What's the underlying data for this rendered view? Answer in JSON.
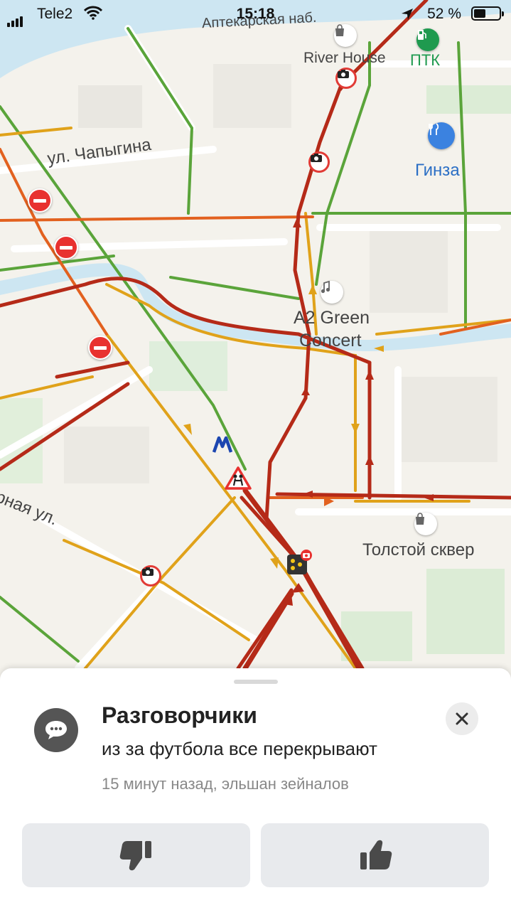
{
  "status_bar": {
    "carrier": "Tele2",
    "time": "15:18",
    "battery_percent": "52 %",
    "battery_level": 0.52
  },
  "map": {
    "labels": {
      "embankment": "Аптекарская наб.",
      "street_chapygina": "ул. Чапыгина",
      "street_partial": "рная ул.",
      "river_house": "River House",
      "ptk": "ПТК",
      "ginza": "Гинза",
      "a2_line1": "A2 Green",
      "a2_line2": "Concert",
      "tolstoy": "Толстой сквер"
    },
    "colors": {
      "jam": "#b52a18",
      "heavy": "#e2611f",
      "medium": "#e0a21a",
      "free": "#5aa43a",
      "water": "#cde6f2",
      "metro": "#1c46b0"
    },
    "icons": [
      "camera-icon",
      "no-entry-icon",
      "shopping-bag-icon",
      "fuel-icon",
      "restaurant-icon",
      "music-icon",
      "metro-icon",
      "children-warning-icon",
      "traffic-light-icon"
    ]
  },
  "sheet": {
    "title": "Разговорчики",
    "message": "из за  футбола все перекрывают",
    "meta": "15 минут назад, эльшан зейналов",
    "dislike_icon": "thumbs-down-icon",
    "like_icon": "thumbs-up-icon",
    "close_icon": "close-icon"
  }
}
